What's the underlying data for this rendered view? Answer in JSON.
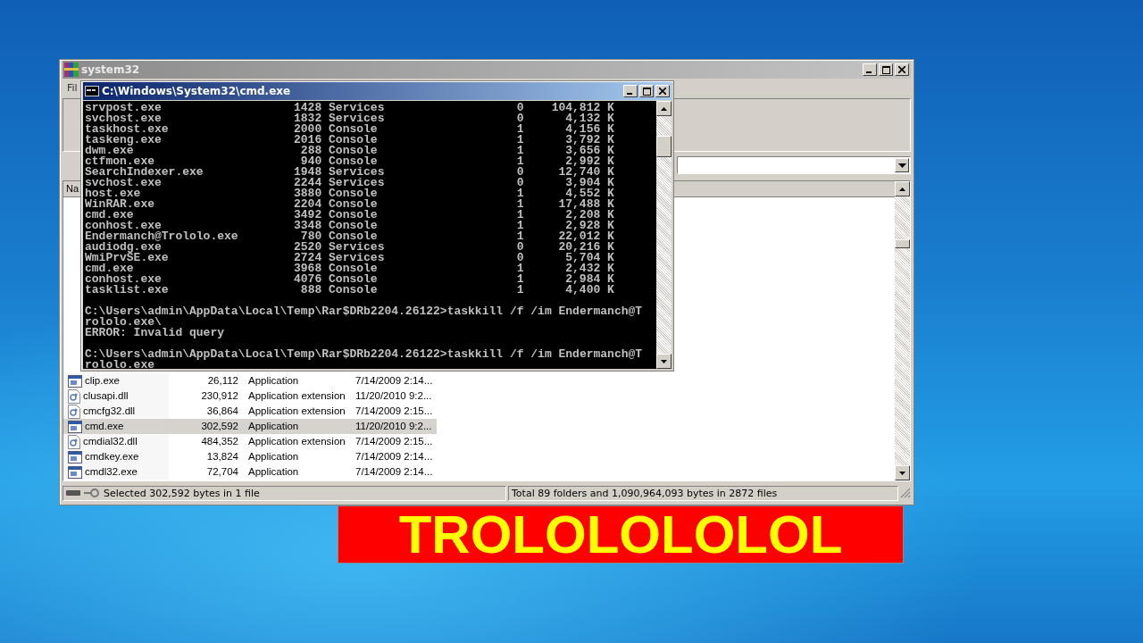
{
  "winrar": {
    "title": "system32",
    "menu": [
      "Fil"
    ],
    "columns": [
      "Na"
    ],
    "files": [
      {
        "name": "clip.exe",
        "size": "26,112",
        "type": "Application",
        "modified": "7/14/2009 2:14...",
        "kind": "application",
        "selected": false
      },
      {
        "name": "clusapi.dll",
        "size": "230,912",
        "type": "Application extension",
        "modified": "11/20/2010 9:2...",
        "kind": "extension",
        "selected": false
      },
      {
        "name": "cmcfg32.dll",
        "size": "36,864",
        "type": "Application extension",
        "modified": "7/14/2009 2:15...",
        "kind": "extension",
        "selected": false
      },
      {
        "name": "cmd.exe",
        "size": "302,592",
        "type": "Application",
        "modified": "11/20/2010 9:2...",
        "kind": "application",
        "selected": true
      },
      {
        "name": "cmdial32.dll",
        "size": "484,352",
        "type": "Application extension",
        "modified": "7/14/2009 2:15...",
        "kind": "extension",
        "selected": false
      },
      {
        "name": "cmdkey.exe",
        "size": "13,824",
        "type": "Application",
        "modified": "7/14/2009 2:14...",
        "kind": "application",
        "selected": false
      },
      {
        "name": "cmdl32.exe",
        "size": "72,704",
        "type": "Application",
        "modified": "7/14/2009 2:14...",
        "kind": "application",
        "selected": false
      }
    ],
    "status_left": "Selected 302,592 bytes in 1 file",
    "status_right": "Total 89 folders and 1,090,964,093 bytes in 2872 files"
  },
  "console": {
    "title": "C:\\Windows\\System32\\cmd.exe",
    "processes": [
      {
        "name": "srvpost.exe",
        "pid": "1428",
        "session": "Services",
        "session_no": "0",
        "mem": "104,812 K"
      },
      {
        "name": "svchost.exe",
        "pid": "1832",
        "session": "Services",
        "session_no": "0",
        "mem": "4,132 K"
      },
      {
        "name": "taskhost.exe",
        "pid": "2000",
        "session": "Console",
        "session_no": "1",
        "mem": "4,156 K"
      },
      {
        "name": "taskeng.exe",
        "pid": "2016",
        "session": "Console",
        "session_no": "1",
        "mem": "3,792 K"
      },
      {
        "name": "dwm.exe",
        "pid": "288",
        "session": "Console",
        "session_no": "1",
        "mem": "3,656 K"
      },
      {
        "name": "ctfmon.exe",
        "pid": "940",
        "session": "Console",
        "session_no": "1",
        "mem": "2,992 K"
      },
      {
        "name": "SearchIndexer.exe",
        "pid": "1948",
        "session": "Services",
        "session_no": "0",
        "mem": "12,740 K"
      },
      {
        "name": "svchost.exe",
        "pid": "2244",
        "session": "Services",
        "session_no": "0",
        "mem": "3,904 K"
      },
      {
        "name": "host.exe",
        "pid": "3880",
        "session": "Console",
        "session_no": "1",
        "mem": "4,552 K"
      },
      {
        "name": "WinRAR.exe",
        "pid": "2204",
        "session": "Console",
        "session_no": "1",
        "mem": "17,488 K"
      },
      {
        "name": "cmd.exe",
        "pid": "3492",
        "session": "Console",
        "session_no": "1",
        "mem": "2,208 K"
      },
      {
        "name": "conhost.exe",
        "pid": "3348",
        "session": "Console",
        "session_no": "1",
        "mem": "2,928 K"
      },
      {
        "name": "Endermanch@Trololo.exe",
        "pid": "780",
        "session": "Console",
        "session_no": "1",
        "mem": "22,012 K"
      },
      {
        "name": "audiodg.exe",
        "pid": "2520",
        "session": "Services",
        "session_no": "0",
        "mem": "20,216 K"
      },
      {
        "name": "WmiPrvSE.exe",
        "pid": "2724",
        "session": "Services",
        "session_no": "0",
        "mem": "5,704 K"
      },
      {
        "name": "cmd.exe",
        "pid": "3968",
        "session": "Console",
        "session_no": "1",
        "mem": "2,432 K"
      },
      {
        "name": "conhost.exe",
        "pid": "4076",
        "session": "Console",
        "session_no": "1",
        "mem": "2,984 K"
      },
      {
        "name": "tasklist.exe",
        "pid": "888",
        "session": "Console",
        "session_no": "1",
        "mem": "4,400 K"
      }
    ],
    "blocks": [
      {
        "lines": [
          "C:\\Users\\admin\\AppData\\Local\\Temp\\Rar$DRb2204.26122>taskkill /f /im Endermanch@T",
          "rololo.exe\\",
          "ERROR: Invalid query"
        ]
      },
      {
        "lines": [
          "C:\\Users\\admin\\AppData\\Local\\Temp\\Rar$DRb2204.26122>taskkill /f /im Endermanch@T",
          "rololo.exe"
        ]
      }
    ]
  },
  "banner": {
    "text": "TROLOLOLOLOL"
  }
}
